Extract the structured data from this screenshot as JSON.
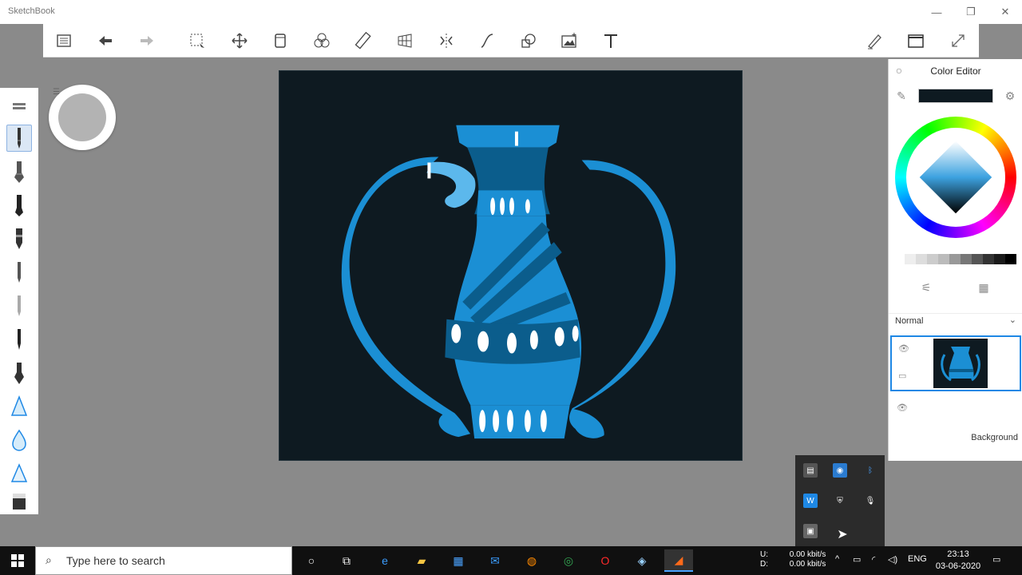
{
  "app": {
    "title": "SketchBook"
  },
  "window_controls": [
    {
      "name": "minimize",
      "glyph": "—"
    },
    {
      "name": "restore",
      "glyph": "❐"
    },
    {
      "name": "close",
      "glyph": "✕"
    }
  ],
  "toolbar": {
    "tools": [
      "lagoon-icon",
      "undo-icon",
      "redo-icon",
      "select-icon",
      "transform-icon",
      "crop-icon",
      "symmetry-circles-icon",
      "ruler-icon",
      "perspective-icon",
      "symmetry-icon",
      "curve-icon",
      "shape-icon",
      "image-icon",
      "text-icon"
    ],
    "right_tools": [
      "brush-toggle-icon",
      "window-icon",
      "fullscreen-icon"
    ]
  },
  "color_editor": {
    "title": "Color Editor",
    "current_color": "#0e1a21",
    "blend_mode": "Normal",
    "gray_swatches": [
      "#ffffff",
      "#eeeeee",
      "#dddddd",
      "#cccccc",
      "#bbbbbb",
      "#999999",
      "#777777",
      "#555555",
      "#333333",
      "#1a1a1a",
      "#000000"
    ]
  },
  "layers": {
    "background_label": "Background"
  },
  "taskbar": {
    "search_placeholder": "Type here to search",
    "network": {
      "upload_label": "U:",
      "download_label": "D:",
      "upload": "0.00 kbit/s",
      "download": "0.00 kbit/s"
    },
    "language": "ENG",
    "time": "23:13",
    "date": "03-06-2020"
  },
  "colors": {
    "canvas_bg": "#0e1a21",
    "vase_blue": "#1b8fd4",
    "vase_light": "#5cb8ec",
    "vase_dark": "#0b5d8c",
    "accent": "#1e88e5"
  }
}
